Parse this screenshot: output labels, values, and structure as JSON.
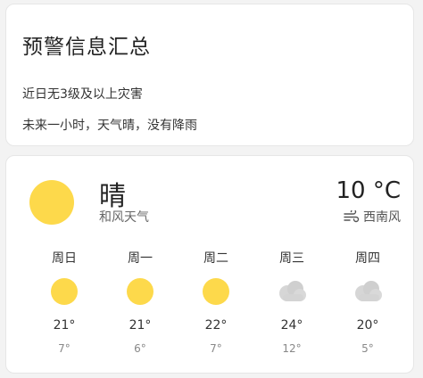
{
  "alert": {
    "title": "预警信息汇总",
    "line1": "近日无3级及以上灾害",
    "line2": "未来一小时，天气晴，没有降雨"
  },
  "current": {
    "icon": "sun-icon",
    "condition": "晴",
    "description": "和风天气",
    "temperature": "10 °C",
    "wind_icon": "wind-icon",
    "wind": "西南风"
  },
  "forecast": [
    {
      "day": "周日",
      "icon": "sun-icon",
      "high": "21°",
      "low": "7°"
    },
    {
      "day": "周一",
      "icon": "sun-icon",
      "high": "21°",
      "low": "6°"
    },
    {
      "day": "周二",
      "icon": "sun-icon",
      "high": "22°",
      "low": "7°"
    },
    {
      "day": "周三",
      "icon": "cloud-icon",
      "high": "24°",
      "low": "12°"
    },
    {
      "day": "周四",
      "icon": "cloud-icon",
      "high": "20°",
      "low": "5°"
    }
  ],
  "colors": {
    "sun": "#fdd94b",
    "cloud": "#cfcfcf",
    "card_background": "#ffffff",
    "page_background": "#f3f3f3"
  }
}
